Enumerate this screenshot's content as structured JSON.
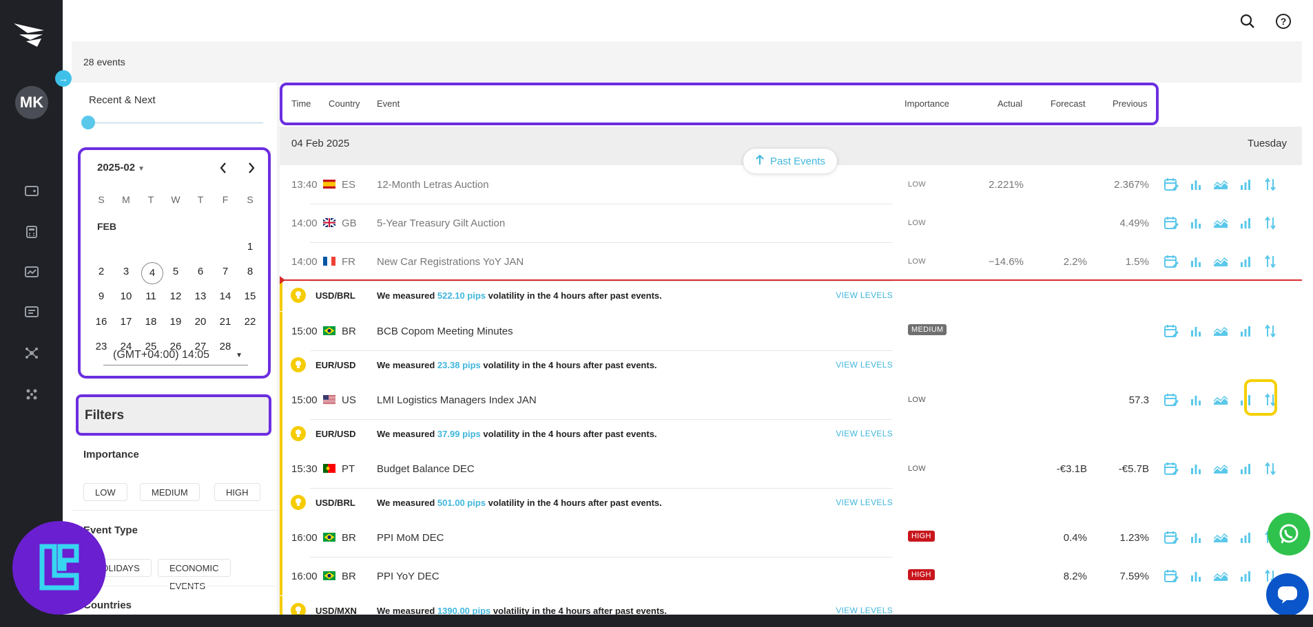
{
  "nav": {
    "avatar_initials": "MK",
    "icons": [
      "wallet-icon",
      "calculator-icon",
      "chart-card-icon",
      "message-icon",
      "network-icon",
      "apps-icon"
    ]
  },
  "topbar": {
    "icons": [
      "search-icon",
      "help-icon"
    ]
  },
  "summary": {
    "events_count": "28 events"
  },
  "sidebar": {
    "range_label": "Recent & Next",
    "calendar": {
      "month_label": "2025-02",
      "month_short": "FEB",
      "weekdays": [
        "S",
        "M",
        "T",
        "W",
        "T",
        "F",
        "S"
      ],
      "selected_day": "4",
      "timezone": "(GMT+04:00) 14:05"
    },
    "filters_title": "Filters",
    "importance_label": "Importance",
    "importance_options": [
      "LOW",
      "MEDIUM",
      "HIGH"
    ],
    "event_type_label": "Event Type",
    "event_type_options": [
      "HOLIDAYS",
      "ECONOMIC EVENTS"
    ],
    "countries_label": "Countries"
  },
  "table": {
    "headers": {
      "time": "Time",
      "country": "Country",
      "event": "Event",
      "importance": "Importance",
      "actual": "Actual",
      "forecast": "Forecast",
      "previous": "Previous"
    },
    "date": "04 Feb 2025",
    "weekday": "Tuesday",
    "past_events_label": "Past Events",
    "rows": [
      {
        "time": "13:40",
        "country": "ES",
        "event": "12-Month Letras Auction",
        "importance": "LOW",
        "actual": "2.221%",
        "forecast": "",
        "previous": "2.367%"
      },
      {
        "time": "14:00",
        "country": "GB",
        "event": "5-Year Treasury Gilt Auction",
        "importance": "LOW",
        "actual": "",
        "forecast": "",
        "previous": "4.49%"
      },
      {
        "time": "14:00",
        "country": "FR",
        "event": "New Car Registrations YoY JAN",
        "importance": "LOW",
        "actual": "−14.6%",
        "forecast": "2.2%",
        "previous": "1.5%"
      },
      {
        "time": "15:00",
        "country": "BR",
        "event": "BCB Copom Meeting Minutes",
        "importance": "MEDIUM",
        "actual": "",
        "forecast": "",
        "previous": ""
      },
      {
        "time": "15:00",
        "country": "US",
        "event": "LMI Logistics Managers Index JAN",
        "importance": "LOW",
        "actual": "",
        "forecast": "",
        "previous": "57.3"
      },
      {
        "time": "15:30",
        "country": "PT",
        "event": "Budget Balance DEC",
        "importance": "LOW",
        "actual": "",
        "forecast": "-€3.1B",
        "previous": "-€5.7B"
      },
      {
        "time": "16:00",
        "country": "BR",
        "event": "PPI MoM DEC",
        "importance": "HIGH",
        "actual": "",
        "forecast": "0.4%",
        "previous": "1.23%"
      },
      {
        "time": "16:00",
        "country": "BR",
        "event": "PPI YoY DEC",
        "importance": "HIGH",
        "actual": "",
        "forecast": "8.2%",
        "previous": "7.59%"
      }
    ],
    "volatility": [
      {
        "pair": "USD/BRL",
        "prefix": "We measured ",
        "pips": "522.10 pips",
        "suffix": " volatility in the 4 hours after past events.",
        "link": "VIEW LEVELS"
      },
      {
        "pair": "EUR/USD",
        "prefix": "We measured ",
        "pips": "23.38 pips",
        "suffix": " volatility in the 4 hours after past events.",
        "link": "VIEW LEVELS"
      },
      {
        "pair": "EUR/USD",
        "prefix": "We measured ",
        "pips": "37.99 pips",
        "suffix": " volatility in the 4 hours after past events.",
        "link": "VIEW LEVELS"
      },
      {
        "pair": "USD/BRL",
        "prefix": "We measured ",
        "pips": "501.00 pips",
        "suffix": " volatility in the 4 hours after past events.",
        "link": "VIEW LEVELS"
      },
      {
        "pair": "USD/MXN",
        "prefix": "We measured ",
        "pips": "1390.00 pips",
        "suffix": " volatility in the 4 hours after past events.",
        "link": "VIEW LEVELS"
      }
    ],
    "row_action_icons": [
      "calendar-edit-icon",
      "bar-chart-icon",
      "area-chart-icon",
      "histogram-icon",
      "sort-arrows-icon"
    ]
  },
  "colors": {
    "accent": "#3fb6dc",
    "purple_highlight": "#6c2ee0",
    "yellow": "#f5cc00",
    "high_badge": "#c8161d",
    "medium_badge": "#6f6f6f",
    "nav_bg": "#1f2126"
  }
}
